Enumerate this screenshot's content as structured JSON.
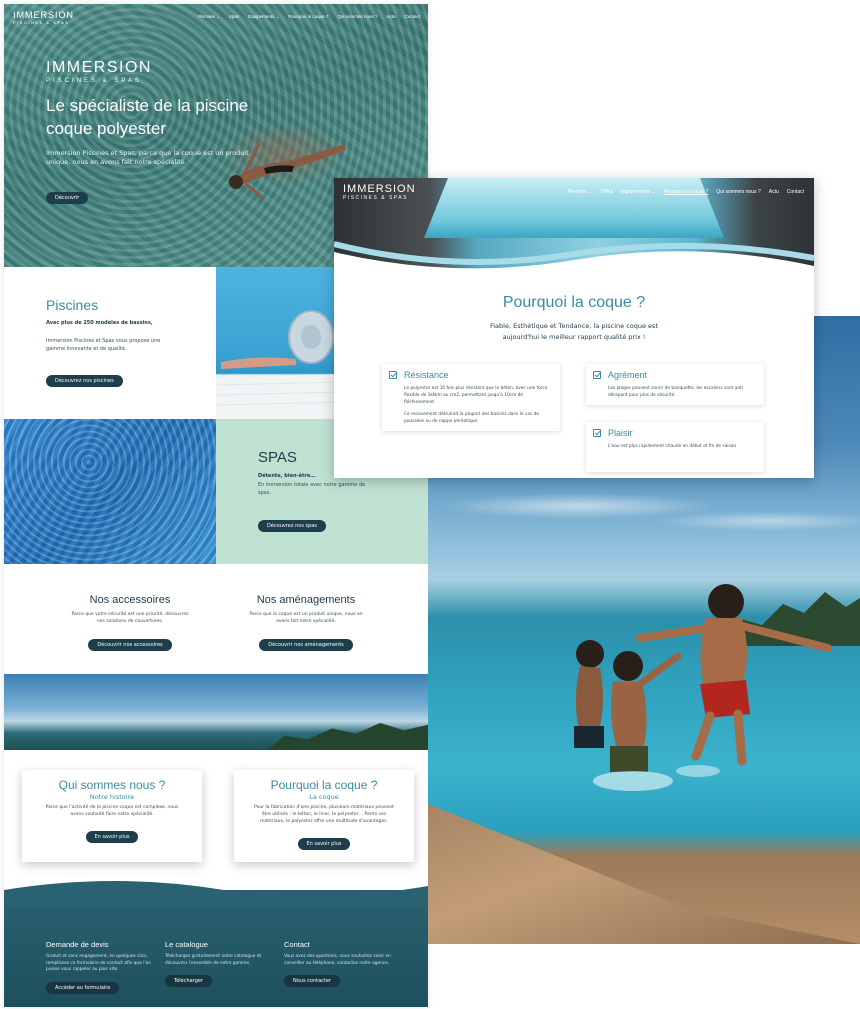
{
  "home": {
    "logo": {
      "brand": "IMMERSION",
      "tagline": "PISCINES & SPAS"
    },
    "nav": [
      "Piscines ⌄",
      "Spas",
      "Equipements ⌄",
      "Pourquoi la coque ?",
      "Qui sommes nous ?",
      "Actu",
      "Contact"
    ],
    "hero": {
      "title": "Le spécialiste de la piscine coque polyester",
      "text": "Immersion Piscines et Spas, parce que la coque est un produit unique, nous en avons fait notre spécialité.",
      "button": "Découvrir"
    },
    "piscines": {
      "title": "Piscines",
      "subtitle": "Avec plus de 250 modèles de bassins,",
      "text": "Immersion Piscines et Spas vous propose une gamme innovante et de qualité.",
      "button": "Découvrez nos piscines"
    },
    "spas": {
      "title": "SPAS",
      "subtitle": "Détente, bien-être…",
      "text": "En immersion totale avec notre gamme de spas.",
      "button": "Découvrez nos spas"
    },
    "accessoires": {
      "title": "Nos accessoires",
      "text": "Parce que votre sécurité est une priorité, découvrez nos solutions de couvertures.",
      "button": "Découvrir nos accessoires"
    },
    "amenagements": {
      "title": "Nos aménagements",
      "text": "Parce que la coque est un produit unique, nous en avons fait notre spécialité.",
      "button": "Découvrir nos aménagements"
    },
    "qui": {
      "title": "Qui sommes nous ?",
      "subtitle": "Notre histoire",
      "text": "Parce que l'activité de la piscine coque est complexe, nous avons souhaité faire notre spécialité.",
      "button": "En savoir plus"
    },
    "pourquoi": {
      "title": "Pourquoi la coque ?",
      "subtitle": "La coque",
      "text": "Pour la fabrication d'une piscine, plusieurs matériaux peuvent être utilisés : le béton, le liner, le polyester… Parmi ces matériaux, le polyester offre une multitude d'avantages.",
      "button": "En savoir plus"
    },
    "footer": [
      {
        "title": "Demande de devis",
        "text": "Gratuit et sans engagement, en quelques clics, remplissez ce formulaire de contact afin que l'on puisse vous rappeler au plus vite.",
        "button": "Accéder au formulaire"
      },
      {
        "title": "Le catalogue",
        "text": "Téléchargez gratuitement notre catalogue et découvrez l'ensemble de notre gamme.",
        "button": "Télécharger"
      },
      {
        "title": "Contact",
        "text": "Vous avez des questions, nous souhaitez venir en conseiller au téléphone, contactez notre agence.",
        "button": "Nous contacter"
      }
    ]
  },
  "coque_page": {
    "logo": {
      "brand": "IMMERSION",
      "tagline": "PISCINES & SPAS"
    },
    "nav": [
      "Piscines ⌄",
      "SPAS",
      "Equipements ⌄",
      "Pourquoi la coque ?",
      "Qui sommes nous ?",
      "Actu",
      "Contact"
    ],
    "title": "Pourquoi la coque ?",
    "subtitle": "Fiable, Esthétique et Tendance, la piscine coque est aujourd'hui le meilleur rapport qualité prix !",
    "features": [
      {
        "title": "Résistance",
        "text": "Le polyester est 10 fois plus résistant que le béton, avec une force flexible de 1kN/m au cm2, permettant jusqu'à 10cm de fléchissement.",
        "text2": "Ce mouvement détruirait la plupart des bassins dans le cas de poussées ou de nappe phréatique."
      },
      {
        "title": "Agrément",
        "text": "Les plages peuvent servir de banquette, les escaliers sont anti dérapant pour plus de sécurité."
      },
      {
        "title": "Plaisir",
        "text": "L'eau est plus rapidement chaude en début et fin de saison"
      }
    ]
  }
}
